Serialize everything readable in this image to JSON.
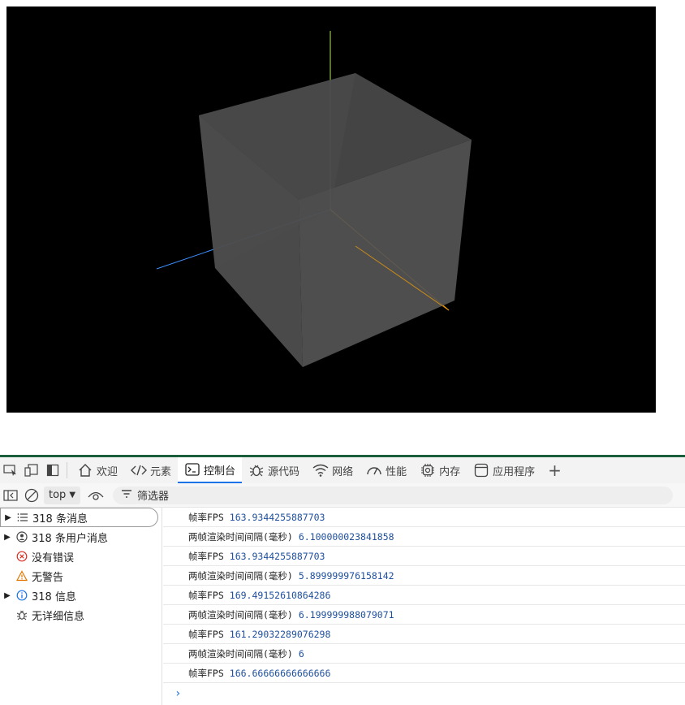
{
  "tabs": [
    {
      "label": "欢迎",
      "icon": "home-icon"
    },
    {
      "label": "元素",
      "icon": "code-icon"
    },
    {
      "label": "控制台",
      "icon": "console-icon",
      "active": true
    },
    {
      "label": "源代码",
      "icon": "bug-icon"
    },
    {
      "label": "网络",
      "icon": "wifi-icon"
    },
    {
      "label": "性能",
      "icon": "gauge-icon"
    },
    {
      "label": "内存",
      "icon": "chip-icon"
    },
    {
      "label": "应用程序",
      "icon": "app-icon"
    }
  ],
  "filter_bar": {
    "context": "top",
    "filter_placeholder": "筛选器"
  },
  "sidebar": {
    "items": [
      {
        "label": "318 条消息",
        "icon": "list-icon",
        "expandable": true
      },
      {
        "label": "318 条用户消息",
        "icon": "user-icon",
        "expandable": true
      },
      {
        "label": "没有错误",
        "icon": "error-icon",
        "expandable": false
      },
      {
        "label": "无警告",
        "icon": "warning-icon",
        "expandable": false
      },
      {
        "label": "318 信息",
        "icon": "info-icon",
        "expandable": true
      },
      {
        "label": "无详细信息",
        "icon": "verbose-bug-icon",
        "expandable": false
      }
    ]
  },
  "console": {
    "messages": [
      {
        "label": "帧率FPS",
        "value": "163.9344255887703"
      },
      {
        "label": "两帧渲染时间间隔(毫秒)",
        "value": "6.100000023841858"
      },
      {
        "label": "帧率FPS",
        "value": "163.9344255887703"
      },
      {
        "label": "两帧渲染时间间隔(毫秒)",
        "value": "5.899999976158142"
      },
      {
        "label": "帧率FPS",
        "value": "169.49152610864286"
      },
      {
        "label": "两帧渲染时间间隔(毫秒)",
        "value": "6.199999988079071"
      },
      {
        "label": "帧率FPS",
        "value": "161.29032289076298"
      },
      {
        "label": "两帧渲染时间间隔(毫秒)",
        "value": "6"
      },
      {
        "label": "帧率FPS",
        "value": "166.66666666666666"
      }
    ],
    "prompt": "›"
  },
  "colors": {
    "accent": "#1a73e8",
    "number": "#1e4f9e",
    "canvas_bg": "#000000",
    "axis_x": "#ffa500",
    "axis_y": "#b5e655",
    "axis_z": "#3d8eff",
    "cube": "#555555"
  }
}
